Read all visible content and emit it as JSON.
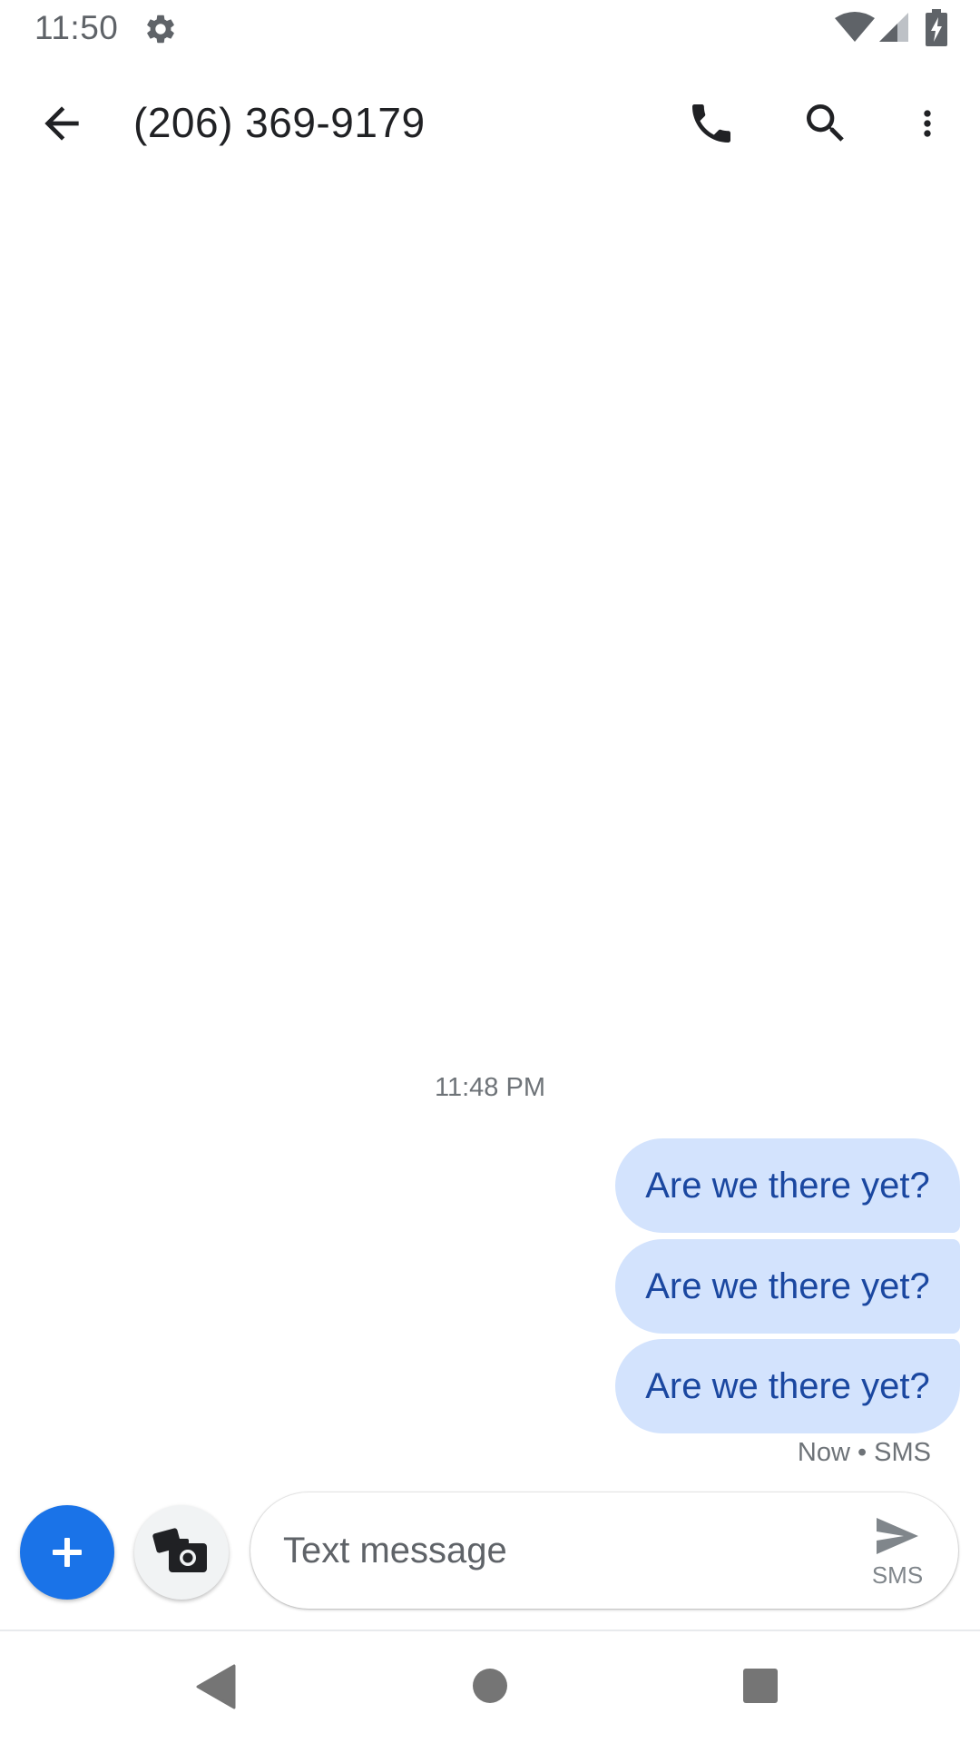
{
  "status_bar": {
    "time": "11:50",
    "icons": [
      "gear-icon",
      "wifi-icon",
      "signal-icon",
      "battery-charging-icon"
    ]
  },
  "app_bar": {
    "title": "(206) 369-9179",
    "icons": [
      "arrow-back-icon",
      "phone-icon",
      "search-icon",
      "more-vert-icon"
    ]
  },
  "conversation": {
    "timestamp": "11:48 PM",
    "messages": [
      {
        "text": "Are we there yet?"
      },
      {
        "text": "Are we there yet?"
      },
      {
        "text": "Are we there yet?"
      }
    ],
    "meta": "Now • SMS"
  },
  "compose": {
    "placeholder": "Text message",
    "value": "",
    "send_label": "SMS",
    "icons": [
      "plus-icon",
      "camera-gallery-icon",
      "send-icon"
    ]
  },
  "colors": {
    "accent": "#1a73e8",
    "bubble": "#d3e3fd",
    "bubble_text": "#1a47a0"
  }
}
